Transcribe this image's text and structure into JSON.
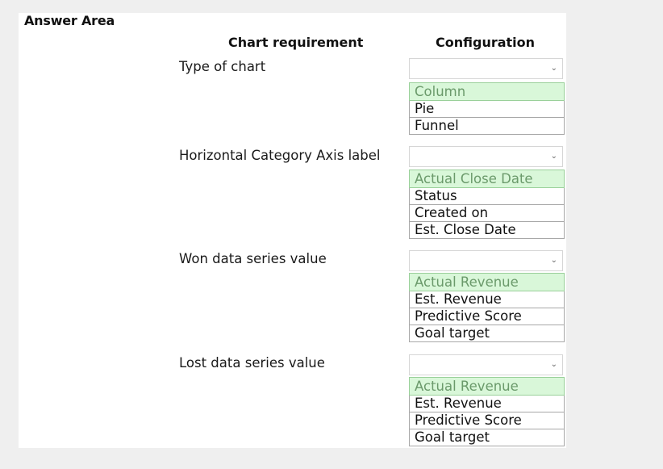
{
  "title": "Answer Area",
  "headers": {
    "requirement": "Chart requirement",
    "configuration": "Configuration"
  },
  "rows": [
    {
      "label": "Type of chart",
      "selected": "",
      "options": [
        "Column",
        "Pie",
        "Funnel"
      ],
      "highlighted_option": "Column"
    },
    {
      "label": "Horizontal Category Axis label",
      "selected": "",
      "options": [
        "Actual Close Date",
        "Status",
        "Created on",
        "Est. Close Date"
      ],
      "highlighted_option": "Actual Close Date"
    },
    {
      "label": "Won data series value",
      "selected": "",
      "options": [
        "Actual Revenue",
        "Est. Revenue",
        "Predictive Score",
        "Goal target"
      ],
      "highlighted_option": "Actual Revenue"
    },
    {
      "label": "Lost data series value",
      "selected": "",
      "options": [
        "Actual Revenue",
        "Est. Revenue",
        "Predictive Score",
        "Goal target"
      ],
      "highlighted_option": "Actual Revenue"
    }
  ],
  "icons": {
    "dropdown": "chevron-down-icon"
  },
  "colors": {
    "highlight_bg": "#d9f7d9",
    "highlight_text": "#6b9a6b",
    "page_bg": "#efefef"
  }
}
